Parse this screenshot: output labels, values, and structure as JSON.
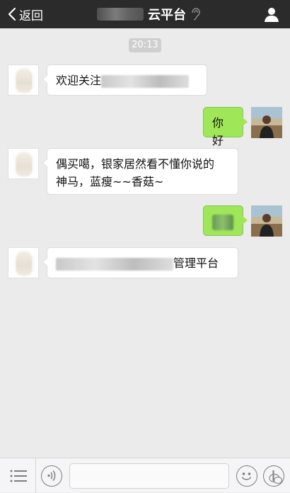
{
  "header": {
    "back_label": "返回",
    "title_suffix": "云平台"
  },
  "chat": {
    "time": "20:13",
    "messages": [
      {
        "side": "left",
        "parts": [
          "欢迎关注"
        ]
      },
      {
        "side": "right",
        "text": "你好"
      },
      {
        "side": "left",
        "lines": [
          "偶买噶，银家居然看不懂你说的",
          "神马，蓝瘦~~香菇~"
        ]
      },
      {
        "side": "right",
        "text": ""
      },
      {
        "side": "left",
        "parts": [
          "管理平台"
        ]
      }
    ]
  },
  "icons": {
    "back": "chevron-left-icon",
    "ear": "ear-icon",
    "profile": "person-icon",
    "menu": "menu-icon",
    "voice": "voice-icon",
    "emoji": "emoji-icon",
    "plus": "plus-icon",
    "watermark": "wechat-logo-icon"
  },
  "colors": {
    "topbar": "#2b2b2b",
    "background": "#ebebeb",
    "bubble_sent": "#9fe658",
    "bubble_received": "#ffffff"
  }
}
